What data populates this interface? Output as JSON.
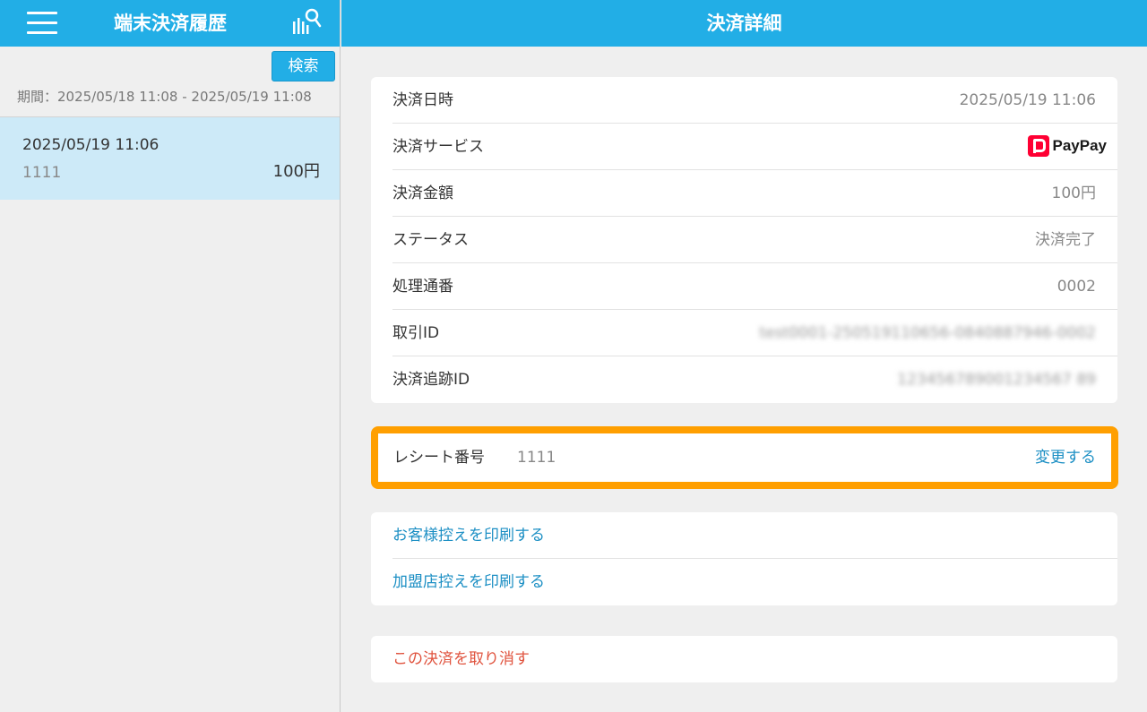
{
  "sidebar": {
    "title": "端末決済履歴",
    "search_label": "検索",
    "period": "期間：2025/05/18 11:08 - 2025/05/19 11:08",
    "items": [
      {
        "datetime": "2025/05/19 11:06",
        "receipt": "1111",
        "amount": "100円"
      }
    ]
  },
  "detail": {
    "title": "決済詳細",
    "rows": [
      {
        "label": "決済日時",
        "value": "2025/05/19 11:06"
      },
      {
        "label": "決済サービス",
        "value": "PayPay"
      },
      {
        "label": "決済金額",
        "value": "100円"
      },
      {
        "label": "ステータス",
        "value": "決済完了"
      },
      {
        "label": "処理通番",
        "value": "0002"
      },
      {
        "label": "取引ID",
        "value": "test0001-250519110656-0840887946-0002"
      },
      {
        "label": "決済追跡ID",
        "value": "123456789001234567 89"
      }
    ],
    "receipt": {
      "label": "レシート番号",
      "value": "1111",
      "change_label": "変更する"
    },
    "print_links": [
      "お客様控えを印刷する",
      "加盟店控えを印刷する"
    ],
    "cancel_label": "この決済を取り消す"
  },
  "colors": {
    "header": "#22aee6",
    "highlight": "#ff9f00",
    "link": "#1c8fc4",
    "danger": "#e0533e",
    "selected": "#cdeaf8"
  }
}
